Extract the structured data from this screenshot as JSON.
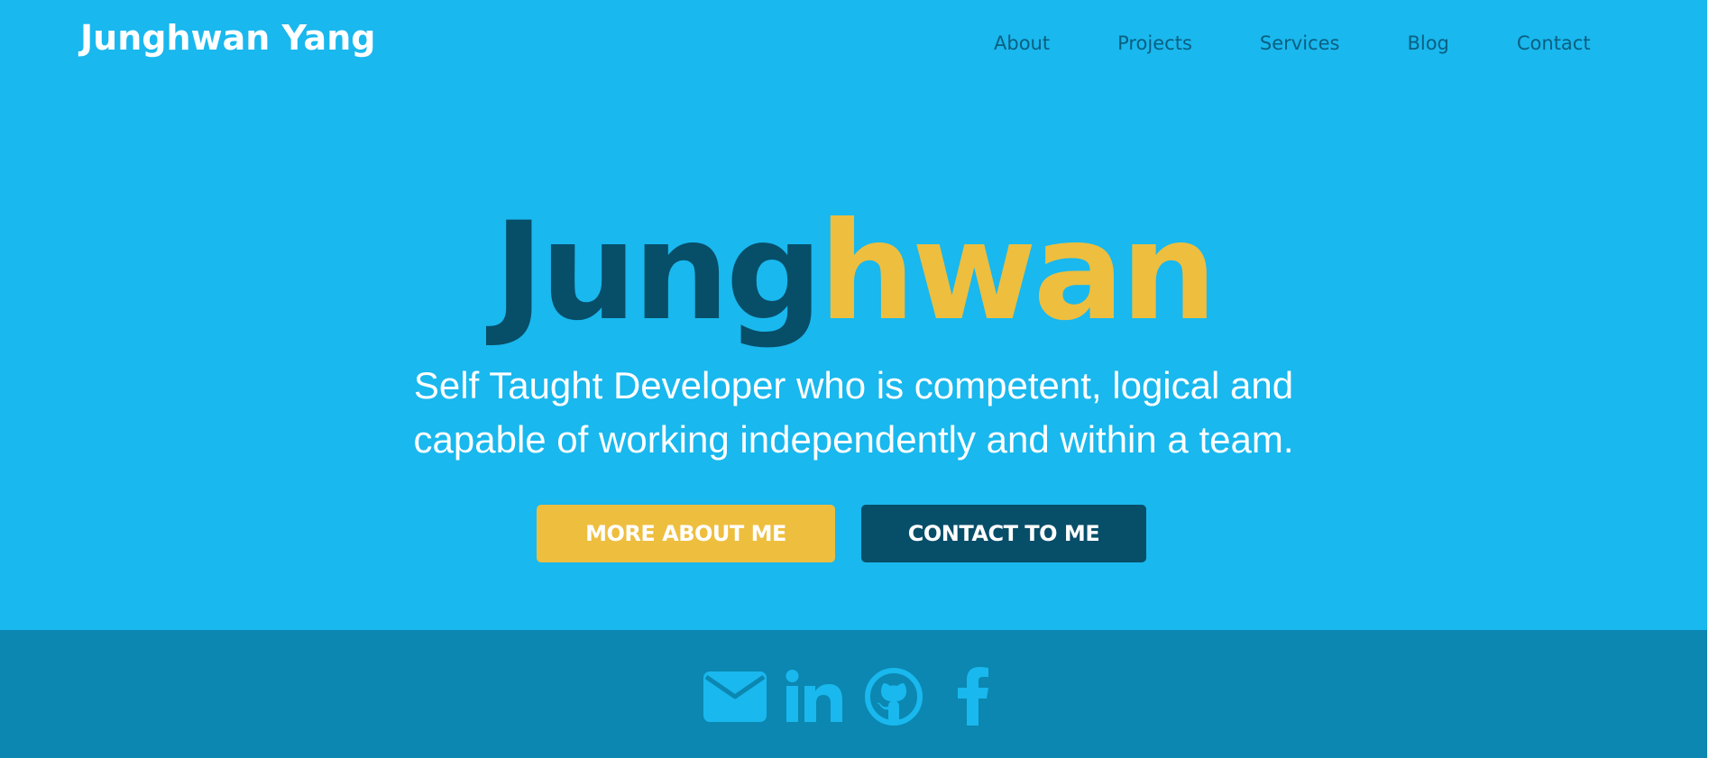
{
  "header": {
    "brand": "Junghwan Yang",
    "nav": [
      "About",
      "Projects",
      "Services",
      "Blog",
      "Contact"
    ]
  },
  "hero": {
    "name_first": "Jung",
    "name_last": "hwan",
    "tagline_line1": "Self Taught Developer who is competent, logical and",
    "tagline_line2": "capable of working independently and within a team.",
    "btn_more": "MORE ABOUT ME",
    "btn_contact": "CONTACT TO ME"
  },
  "footer": {
    "social_icons": [
      "envelope-icon",
      "linkedin-icon",
      "github-icon",
      "facebook-icon"
    ]
  },
  "colors": {
    "background": "#19b8ee",
    "footer": "#0b87b1",
    "dark_accent": "#074e69",
    "yellow_accent": "#eebe3f",
    "nav_text": "#0a5f81"
  }
}
